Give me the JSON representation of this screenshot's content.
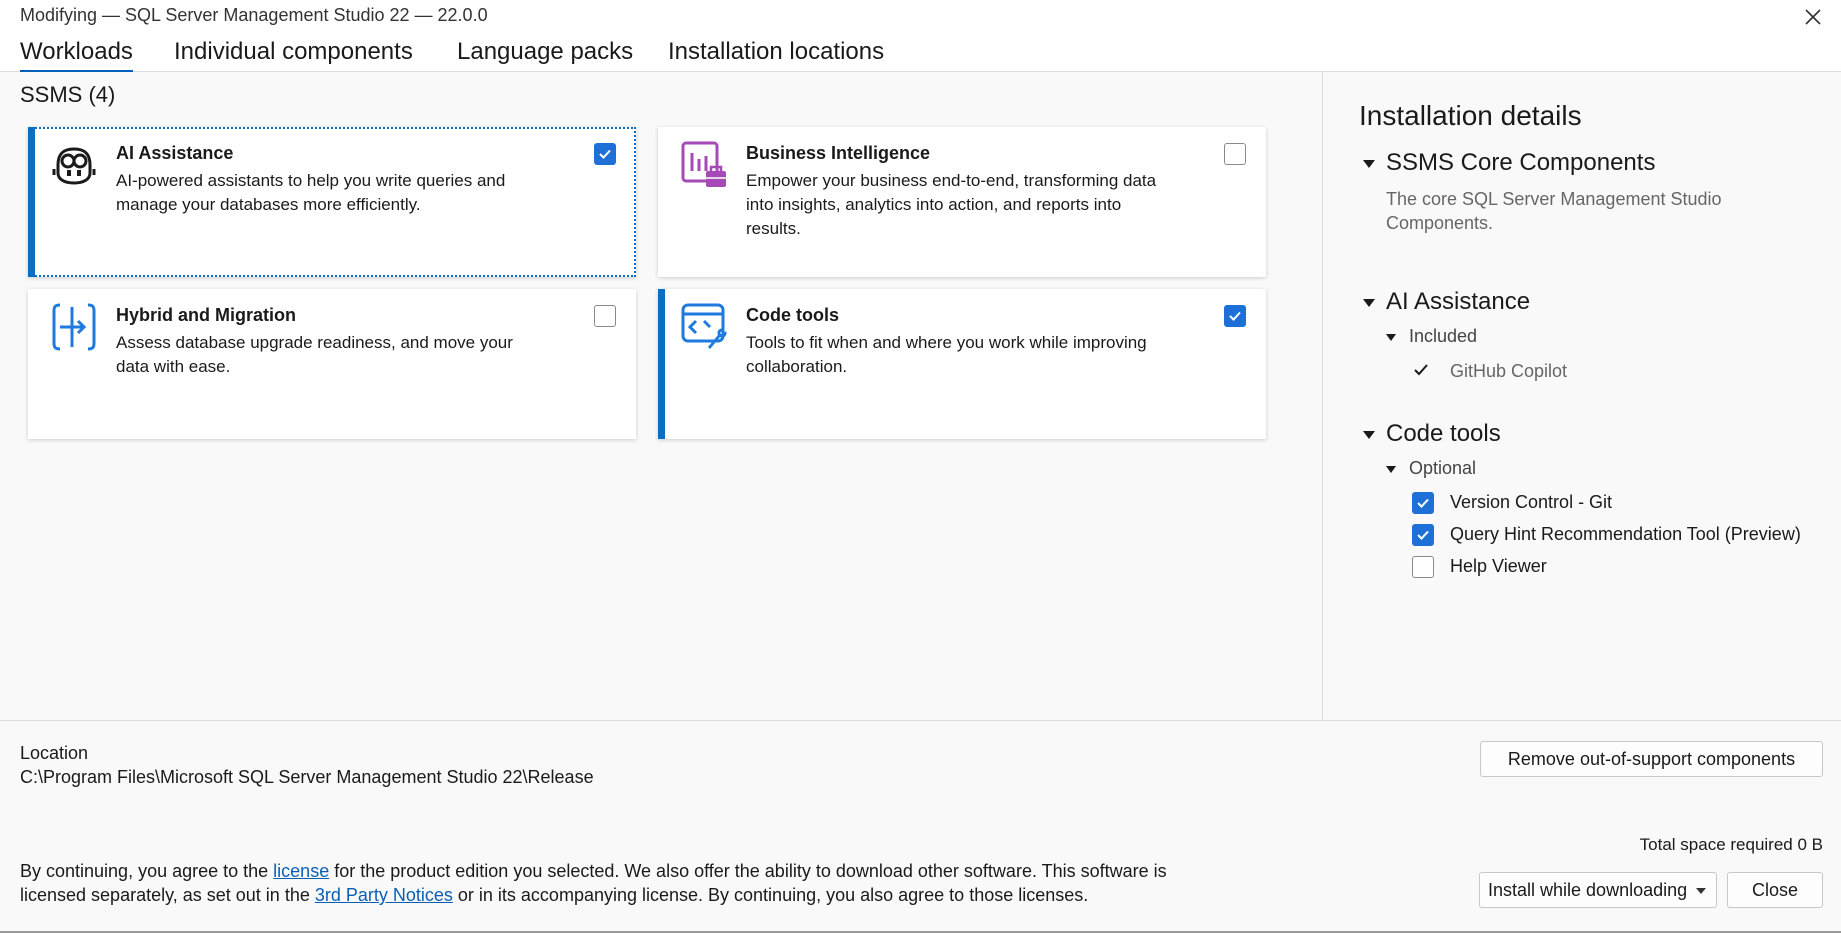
{
  "window": {
    "title": "Modifying — SQL Server Management Studio 22 — 22.0.0",
    "close_icon": "close-icon"
  },
  "tabs": [
    {
      "label": "Workloads",
      "active": true
    },
    {
      "label": "Individual components",
      "active": false
    },
    {
      "label": "Language packs",
      "active": false
    },
    {
      "label": "Installation locations",
      "active": false
    }
  ],
  "workloads": {
    "group_title": "SSMS (4)",
    "cards": [
      {
        "title": "AI Assistance",
        "description": "AI-powered assistants to help you write queries and manage your databases more efficiently.",
        "checked": true,
        "icon": "copilot-icon"
      },
      {
        "title": "Business Intelligence",
        "description": "Empower your business end-to-end, transforming data into insights, analytics into action, and reports into results.",
        "checked": false,
        "icon": "business-intelligence-icon"
      },
      {
        "title": "Hybrid and Migration",
        "description": "Assess database upgrade readiness, and move your data with ease.",
        "checked": false,
        "icon": "migration-icon"
      },
      {
        "title": "Code tools",
        "description": "Tools to fit when and where you work while improving collaboration.",
        "checked": true,
        "icon": "code-tools-icon"
      }
    ]
  },
  "details": {
    "title": "Installation details",
    "core": {
      "title": "SSMS Core Components",
      "description": "The core SQL Server Management Studio Components."
    },
    "ai": {
      "title": "AI Assistance",
      "included_label": "Included",
      "items": [
        {
          "label": "GitHub Copilot"
        }
      ]
    },
    "code": {
      "title": "Code tools",
      "optional_label": "Optional",
      "items": [
        {
          "label": "Version Control - Git",
          "checked": true
        },
        {
          "label": "Query Hint Recommendation Tool (Preview)",
          "checked": true
        },
        {
          "label": "Help Viewer",
          "checked": false
        }
      ]
    }
  },
  "footer": {
    "location_label": "Location",
    "location_path": "C:\\Program Files\\Microsoft SQL Server Management Studio 22\\Release",
    "remove_button": "Remove out-of-support components",
    "space_label": "Total space required  0 B",
    "legal": {
      "part1": "By continuing, you agree to the ",
      "license_link": "license",
      "part2": " for the product edition you selected. We also offer the ability to download other software. This software is licensed separately, as set out in the ",
      "notices_link": "3rd Party Notices",
      "part3": " or in its accompanying license. By continuing, you also agree to those licenses."
    },
    "install_mode": "Install while downloading",
    "close_button": "Close"
  },
  "colors": {
    "accent": "#0a6fc2",
    "checkbox": "#1f6fd8",
    "bi_icon": "#a64ab8",
    "code_icon": "#1f7ae0"
  }
}
